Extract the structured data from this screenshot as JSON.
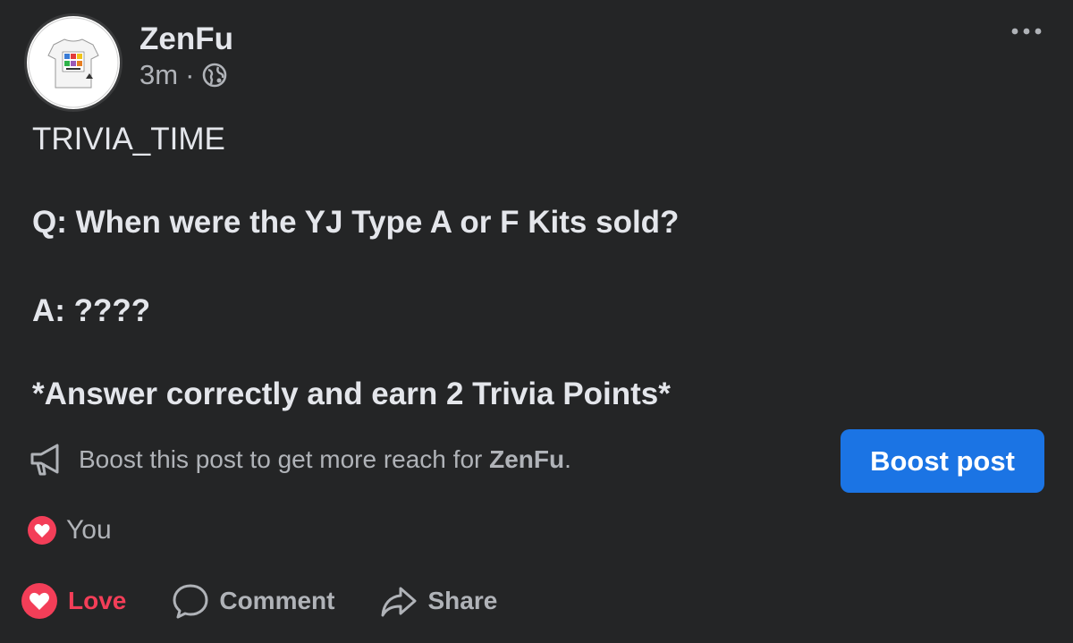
{
  "post": {
    "page_name": "ZenFu",
    "timestamp": "3m",
    "separator": "·",
    "privacy_icon": "globe-icon",
    "more_icon": "more-dots-icon",
    "lines": {
      "title": "TRIVIA_TIME",
      "question": "Q: When were the YJ Type A or F Kits sold?",
      "answer": "A: ????",
      "promo": "*Answer correctly and earn 2 Trivia Points*"
    }
  },
  "boost": {
    "icon": "megaphone-icon",
    "text_prefix": "Boost this post to get more reach for ",
    "text_page": "ZenFu",
    "text_suffix": ".",
    "button_label": "Boost post"
  },
  "reactions": {
    "icon": "love-reaction-icon",
    "label": "You"
  },
  "actions": {
    "love": {
      "icon": "love-icon",
      "label": "Love"
    },
    "comment": {
      "icon": "comment-icon",
      "label": "Comment"
    },
    "share": {
      "icon": "share-icon",
      "label": "Share"
    }
  },
  "colors": {
    "background": "#242526",
    "primary_text": "#e4e6eb",
    "secondary_text": "#b0b3b8",
    "accent_blue": "#1b74e4",
    "love_red": "#f33e58"
  }
}
